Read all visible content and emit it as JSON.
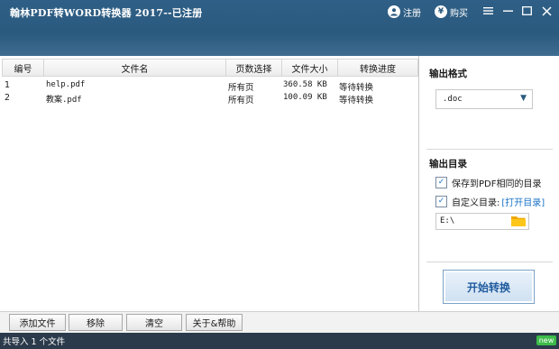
{
  "window": {
    "title": "翰林PDF转WORD转换器 2017--已注册",
    "register_label": "注册",
    "buy_label": "购买"
  },
  "table": {
    "columns": [
      "编号",
      "文件名",
      "页数选择",
      "文件大小",
      "转换进度"
    ],
    "rows": [
      {
        "num": "1",
        "name": "help.pdf",
        "pages": "所有页",
        "size": "360.58 KB",
        "progress": "等待转换"
      },
      {
        "num": "2",
        "name": "教案.pdf",
        "pages": "所有页",
        "size": "100.09 KB",
        "progress": "等待转换"
      }
    ]
  },
  "side": {
    "format_title": "输出格式",
    "format_value": ".doc",
    "dir_title": "输出目录",
    "opt_same_dir": "保存到PDF相同的目录",
    "opt_custom_dir": "自定义目录:",
    "open_dir_link": "[打开目录]",
    "dir_value": "E:\\",
    "same_dir_checked": true,
    "custom_dir_checked": true,
    "start_button": "开始转换"
  },
  "bottom": {
    "add_file": "添加文件",
    "remove": "移除",
    "clear": "清空",
    "about": "关于&帮助"
  },
  "status": {
    "text": "共导入 1 个文件",
    "new_badge": "new"
  }
}
